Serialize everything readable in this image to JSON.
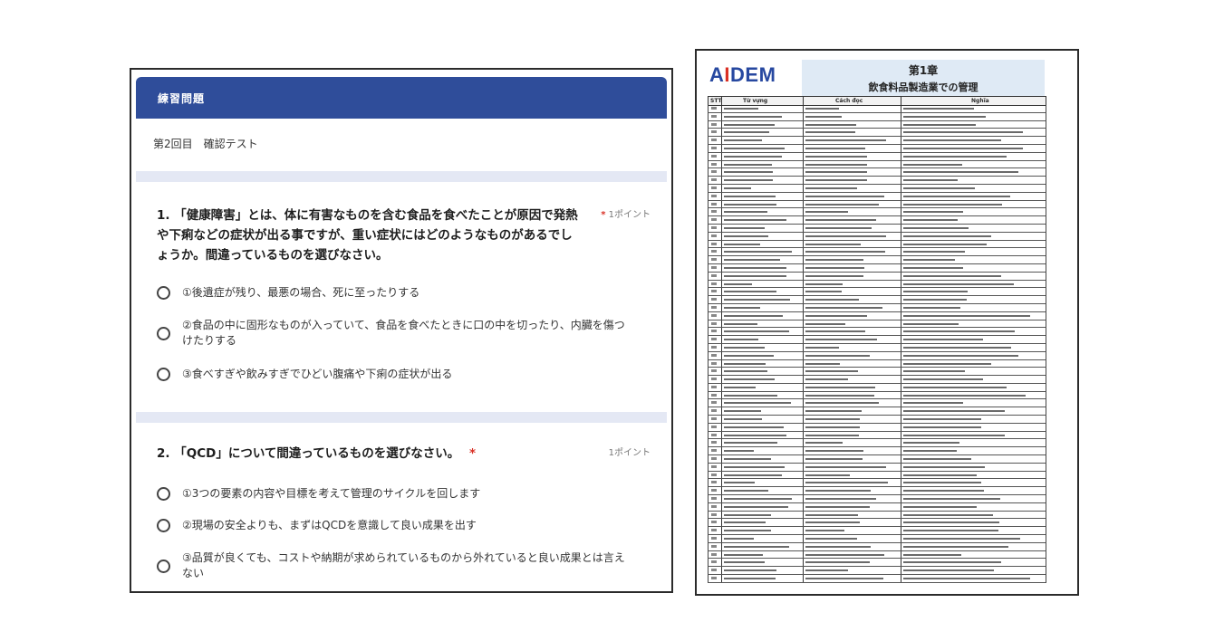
{
  "quiz": {
    "header_title": "練習問題",
    "subtitle": "第2回目　確認テスト",
    "questions": [
      {
        "number": "1.",
        "text": "「健康障害」とは、体に有害なものを含む食品を食べたことが原因で発熱や下痢などの症状が出る事ですが、重い症状にはどのようなものがあるでしょうか。間違っているものを選びなさい。",
        "required_mark": "*",
        "points": "1ポイント",
        "options": [
          "①後遺症が残り、最悪の場合、死に至ったりする",
          "②食品の中に固形なものが入っていて、食品を食べたときに口の中を切ったり、内臓を傷つけたりする",
          "③食べすぎや飲みすぎでひどい腹痛や下痢の症状が出る"
        ]
      },
      {
        "number": "2.",
        "text": "「QCD」について間違っているものを選びなさい。",
        "required_mark": "*",
        "points": "1ポイント",
        "options": [
          "①3つの要素の内容や目標を考えて管理のサイクルを回します",
          "②現場の安全よりも、まずはQCDを意識して良い成果を出す",
          "③品質が良くても、コストや納期が求められているものから外れていると良い成果とは言えない"
        ]
      }
    ]
  },
  "document": {
    "logo_prefix": "A",
    "logo_accent": "I",
    "logo_suffix": "DEM",
    "chapter": "第1章",
    "chapter_title": "飲食料品製造業での管理",
    "columns": [
      "STT",
      "Từ vựng",
      "Cách đọc",
      "Nghĩa"
    ],
    "row_count": 60
  },
  "colors": {
    "header_blue": "#2f4d9a",
    "band": "#e4e8f4",
    "required": "#d93025",
    "logo_blue": "#2748a0",
    "chapter_bg": "#dfeaf5"
  }
}
